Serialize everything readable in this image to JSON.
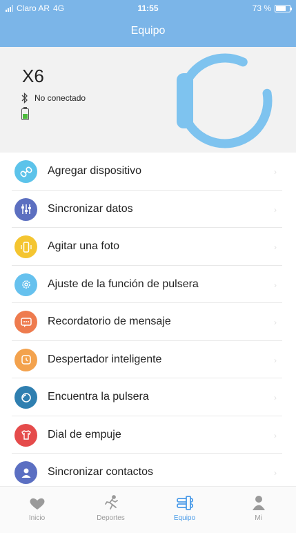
{
  "status_bar": {
    "carrier": "Claro AR",
    "network": "4G",
    "time": "11:55",
    "battery": "73 %"
  },
  "header": {
    "title": "Equipo"
  },
  "device": {
    "name": "X6",
    "connection": "No conectado",
    "battery_level": 0.55
  },
  "menu": [
    {
      "label": "Agregar dispositivo",
      "icon": "link-icon",
      "color": "#5cc3ea"
    },
    {
      "label": "Sincronizar datos",
      "icon": "sliders-icon",
      "color": "#5c6fc0"
    },
    {
      "label": "Agitar una foto",
      "icon": "phone-shake-icon",
      "color": "#f4c531"
    },
    {
      "label": "Ajuste de la función de pulsera",
      "icon": "gear-icon",
      "color": "#66c1ee"
    },
    {
      "label": "Recordatorio de mensaje",
      "icon": "message-icon",
      "color": "#ee7b4e"
    },
    {
      "label": "Despertador inteligente",
      "icon": "alarm-icon",
      "color": "#f3a24d"
    },
    {
      "label": "Encuentra la pulsera",
      "icon": "find-band-icon",
      "color": "#2f7fb0"
    },
    {
      "label": "Dial de empuje",
      "icon": "shirt-icon",
      "color": "#e54b4b"
    },
    {
      "label": "Sincronizar contactos",
      "icon": "contact-icon",
      "color": "#5b6fc2"
    }
  ],
  "tabs": [
    {
      "label": "Inicio",
      "icon": "heart-icon",
      "active": false
    },
    {
      "label": "Deportes",
      "icon": "runner-icon",
      "active": false
    },
    {
      "label": "Equipo",
      "icon": "band-icon",
      "active": true
    },
    {
      "label": "Mi",
      "icon": "person-icon",
      "active": false
    }
  ],
  "colors": {
    "header": "#7bb5e8",
    "accent": "#4a9be8",
    "band": "#7ec3ef"
  }
}
